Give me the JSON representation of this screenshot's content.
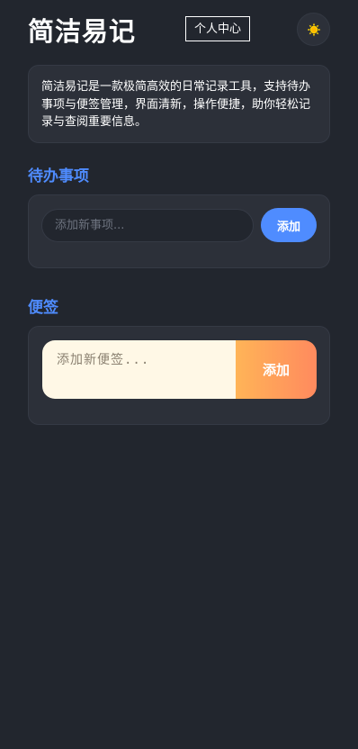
{
  "header": {
    "title": "简洁易记",
    "profile_label": "个人中心",
    "theme_icon": "sun-icon"
  },
  "intro": {
    "text": "简洁易记是一款极简高效的日常记录工具，支持待办事项与便签管理，界面清新，操作便捷，助你轻松记录与查阅重要信息。"
  },
  "todo": {
    "title": "待办事项",
    "input_placeholder": "添加新事项...",
    "add_label": "添加"
  },
  "notes": {
    "title": "便签",
    "input_placeholder": "添加新便签...",
    "add_label": "添加"
  },
  "colors": {
    "background": "#22262e",
    "card": "#2c3039",
    "accent_blue": "#4f8cff",
    "note_bg": "#fff8e6",
    "note_btn_start": "#ffb457",
    "note_btn_end": "#ff8a5e",
    "sun": "#ffd200"
  }
}
